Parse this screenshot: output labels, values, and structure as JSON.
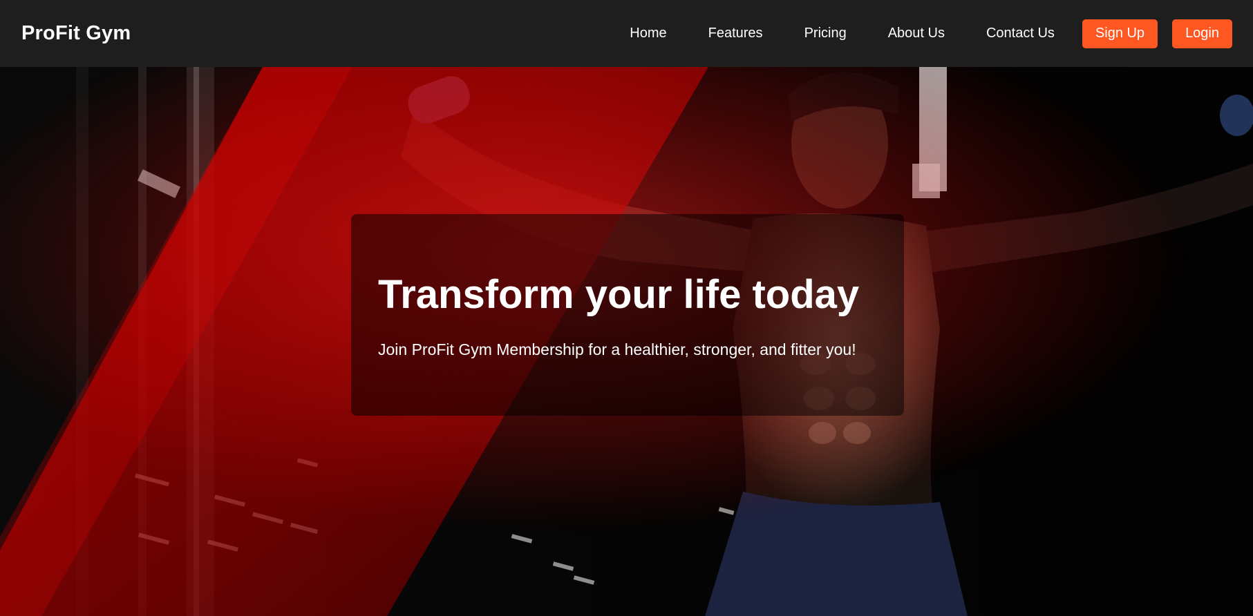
{
  "brand": {
    "name": "ProFit Gym"
  },
  "nav": {
    "links": [
      {
        "label": "Home"
      },
      {
        "label": "Features"
      },
      {
        "label": "Pricing"
      },
      {
        "label": "About Us"
      },
      {
        "label": "Contact Us"
      }
    ],
    "signup_label": "Sign Up",
    "login_label": "Login"
  },
  "hero": {
    "title": "Transform your life today",
    "subtitle": "Join ProFit Gym Membership for a healthier, stronger, and fitter you!",
    "background": "gym-athlete-photo"
  },
  "colors": {
    "navbar_bg": "#1e1e1e",
    "accent": "#ff5722",
    "hero_red": "#c40000",
    "text": "#ffffff"
  }
}
